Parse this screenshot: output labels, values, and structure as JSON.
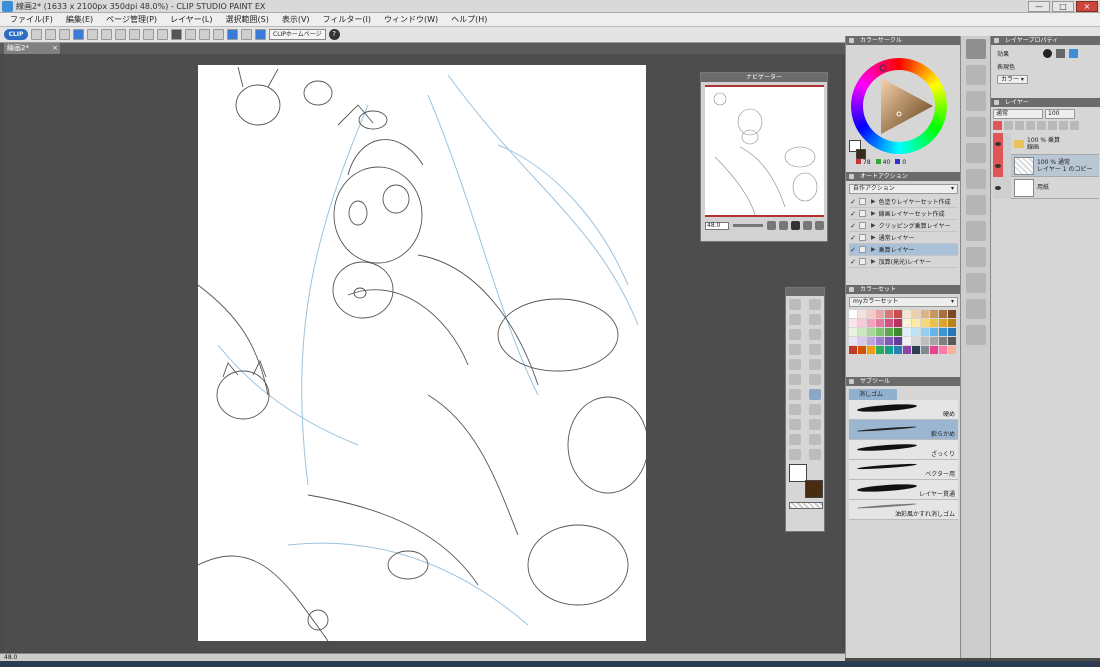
{
  "window": {
    "title": "線画2* (1633 x 2100px 350dpi 48.0%) - CLIP STUDIO PAINT EX",
    "buttons": [
      "—",
      "□",
      "×"
    ]
  },
  "menu": [
    "ファイル(F)",
    "編集(E)",
    "ページ管理(P)",
    "レイヤー(L)",
    "選択範囲(S)",
    "表示(V)",
    "フィルター(I)",
    "ウィンドウ(W)",
    "ヘルプ(H)"
  ],
  "toolbar": {
    "logo": "CLIP",
    "home_label": "CLIPホームページ",
    "help_label": "?"
  },
  "document": {
    "tab_label": "線画2*",
    "tab_close": "×"
  },
  "navigator": {
    "title": "ナビゲーター",
    "zoom": "48.0"
  },
  "color_circle": {
    "title": "カラーサークル",
    "values": [
      {
        "key": "H",
        "value": "78"
      },
      {
        "key": "S",
        "value": "40"
      },
      {
        "key": "V",
        "value": "0"
      }
    ],
    "hue_color": "#f29a2e"
  },
  "auto_action": {
    "title": "オートアクション",
    "set_name": "自作アクション",
    "items": [
      {
        "label": "色塗りレイヤーセット作成",
        "checked": true,
        "selected": false
      },
      {
        "label": "線画レイヤーセット作成",
        "checked": true,
        "selected": false
      },
      {
        "label": "クリッピング乗算レイヤー",
        "checked": true,
        "selected": false
      },
      {
        "label": "通常レイヤー",
        "checked": true,
        "selected": false
      },
      {
        "label": "乗算レイヤー",
        "checked": true,
        "selected": true
      },
      {
        "label": "加算(発光)レイヤー",
        "checked": true,
        "selected": false
      }
    ]
  },
  "color_set": {
    "title": "カラーセット",
    "set_name": "myカラーセット",
    "colors": [
      "#ffffff",
      "#f6e1e1",
      "#f3c9c9",
      "#e9a5a5",
      "#d87676",
      "#c94d4d",
      "#f4e6d2",
      "#ecd0ae",
      "#ddb487",
      "#c79560",
      "#a96f3e",
      "#7a4a25",
      "#fbe4ec",
      "#f8c9d8",
      "#f1a2bc",
      "#e5789e",
      "#d25381",
      "#b53462",
      "#fff5d6",
      "#fde9a8",
      "#f7d777",
      "#ecc04c",
      "#d9a52b",
      "#b88417",
      "#e7f4e1",
      "#cbe8bf",
      "#a8d79a",
      "#7fc46f",
      "#5aa84a",
      "#3c8a2e",
      "#e0f0fa",
      "#bfe2f6",
      "#94cdef",
      "#66b3e4",
      "#3d95d2",
      "#2577b8",
      "#ece4f5",
      "#d8c8ec",
      "#bda4df",
      "#9d7ccd",
      "#7f58b8",
      "#643d9b",
      "#f2f2f2",
      "#d9d9d9",
      "#bfbfbf",
      "#a6a6a6",
      "#808080",
      "#595959",
      "#c0392b",
      "#d35400",
      "#f39c12",
      "#27ae60",
      "#16a085",
      "#2980b9",
      "#8e44ad",
      "#2c3e50",
      "#7f8c8d",
      "#e84393",
      "#fd79a8",
      "#fab1a0"
    ]
  },
  "sub_tool": {
    "title": "サブツール",
    "tab_label": "消しゴム",
    "items": [
      {
        "label": "硬め",
        "selected": false
      },
      {
        "label": "軟らかめ",
        "selected": true
      },
      {
        "label": "ざっくり",
        "selected": false
      },
      {
        "label": "ベクター用",
        "selected": false
      },
      {
        "label": "レイヤー貫通",
        "selected": false
      },
      {
        "label": "油彩風かすれ消しゴム",
        "selected": false
      }
    ]
  },
  "layer_property": {
    "title": "レイヤープロパティ",
    "effect_label": "効果",
    "expression_color_label": "表現色",
    "expression_color_value": "カラー"
  },
  "layer_panel": {
    "title": "レイヤー",
    "blend_mode": "通常",
    "opacity": "100",
    "layers": [
      {
        "line1": "100 % 乗算",
        "line2": "線画",
        "type": "folder",
        "visible": true,
        "selected": false
      },
      {
        "line1": "100 % 通常",
        "line2": "レイヤー 1 のコピー",
        "type": "raster",
        "visible": true,
        "selected": true
      },
      {
        "line1": "用紙",
        "line2": "",
        "type": "paper",
        "visible": true,
        "selected": false
      }
    ]
  },
  "status": {
    "zoom": "48.0"
  }
}
